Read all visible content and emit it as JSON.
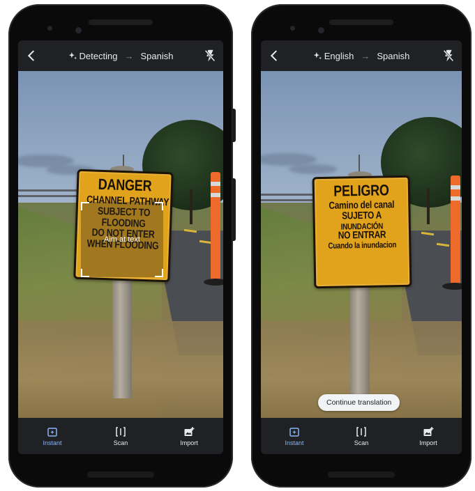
{
  "phones": [
    {
      "top_bar": {
        "source_language": "Detecting",
        "target_language": "Spanish",
        "arrow": "→"
      },
      "sign": {
        "lines": [
          "DANGER",
          "CHANNEL PATHWAY",
          "SUBJECT TO",
          "FLOODING",
          "DO NOT ENTER",
          "WHEN FLOODING"
        ]
      },
      "hint": "Aim at text",
      "bottom_bar": {
        "modes": [
          {
            "label": "Instant",
            "icon": "instant-icon",
            "active": true
          },
          {
            "label": "Scan",
            "icon": "scan-icon",
            "active": false
          },
          {
            "label": "Import",
            "icon": "import-icon",
            "active": false
          }
        ]
      }
    },
    {
      "top_bar": {
        "source_language": "English",
        "target_language": "Spanish",
        "arrow": "→"
      },
      "sign": {
        "lines": [
          "PELIGRO",
          "Camino del canal",
          "SUJETO A",
          "INUNDACIÓN",
          "NO ENTRAR",
          "Cuando la inundacion"
        ]
      },
      "chip": "Continue translation",
      "bottom_bar": {
        "modes": [
          {
            "label": "Instant",
            "icon": "instant-icon",
            "active": true
          },
          {
            "label": "Scan",
            "icon": "scan-icon",
            "active": false
          },
          {
            "label": "Import",
            "icon": "import-icon",
            "active": false
          }
        ]
      }
    }
  ],
  "colors": {
    "active_mode": "#8ab4f8",
    "bar_background": "#202124",
    "sign_yellow": "#e2a31c"
  }
}
